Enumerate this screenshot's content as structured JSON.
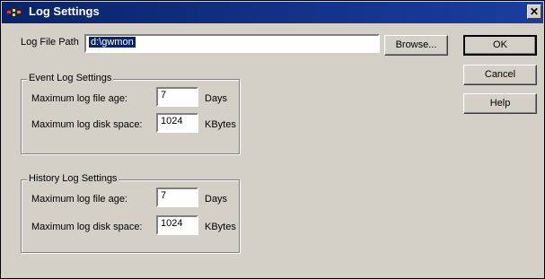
{
  "window": {
    "title": "Log Settings"
  },
  "log_file_path": {
    "label": "Log File Path",
    "value": "d:\\gwmon"
  },
  "buttons": {
    "browse": "Browse...",
    "ok": "OK",
    "cancel": "Cancel",
    "help": "Help"
  },
  "event_log": {
    "title": "Event Log Settings",
    "age_label": "Maximum log file age:",
    "age_value": "7",
    "age_unit": "Days",
    "space_label": "Maximum log disk space:",
    "space_value": "1024",
    "space_unit": "KBytes"
  },
  "history_log": {
    "title": "History Log Settings",
    "age_label": "Maximum log file age:",
    "age_value": "7",
    "age_unit": "Days",
    "space_label": "Maximum log disk space:",
    "space_value": "1024",
    "space_unit": "KBytes"
  }
}
